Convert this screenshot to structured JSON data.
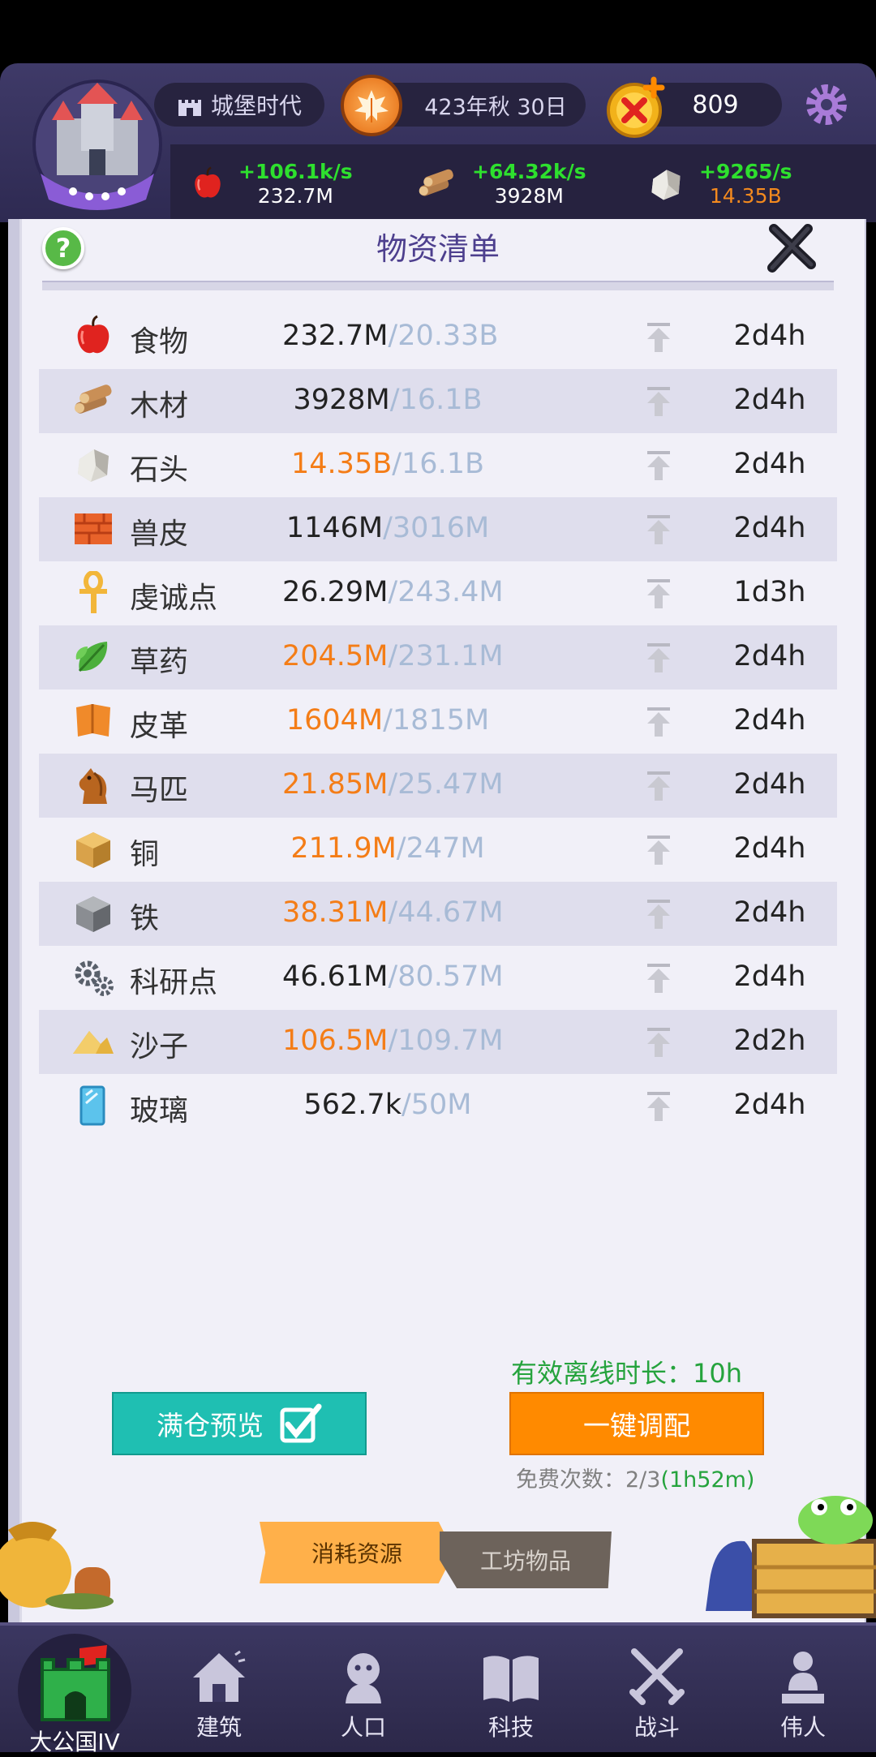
{
  "hud": {
    "era": "城堡时代",
    "date": "423年秋 30日",
    "coins": "809",
    "resources": [
      {
        "icon": "apple-icon",
        "rate": "+106.1k/s",
        "amount": "232.7M",
        "warn": false
      },
      {
        "icon": "wood-icon",
        "rate": "+64.32k/s",
        "amount": "3928M",
        "warn": false
      },
      {
        "icon": "stone-icon",
        "rate": "+9265/s",
        "amount": "14.35B",
        "warn": true
      }
    ]
  },
  "panel": {
    "title": "物资清单",
    "help": "?",
    "items": [
      {
        "icon": "apple-icon",
        "name": "食物",
        "current": "232.7M",
        "max": "/20.33B",
        "warn": false,
        "time": "2d4h"
      },
      {
        "icon": "wood-icon",
        "name": "木材",
        "current": "3928M",
        "max": "/16.1B",
        "warn": false,
        "time": "2d4h"
      },
      {
        "icon": "stone-icon",
        "name": "石头",
        "current": "14.35B",
        "max": "/16.1B",
        "warn": true,
        "time": "2d4h"
      },
      {
        "icon": "hide-icon",
        "name": "兽皮",
        "current": "1146M",
        "max": "/3016M",
        "warn": false,
        "time": "2d4h"
      },
      {
        "icon": "ankh-icon",
        "name": "虔诚点",
        "current": "26.29M",
        "max": "/243.4M",
        "warn": false,
        "time": "1d3h"
      },
      {
        "icon": "herb-icon",
        "name": "草药",
        "current": "204.5M",
        "max": "/231.1M",
        "warn": true,
        "time": "2d4h"
      },
      {
        "icon": "leather-icon",
        "name": "皮革",
        "current": "1604M",
        "max": "/1815M",
        "warn": true,
        "time": "2d4h"
      },
      {
        "icon": "horse-icon",
        "name": "马匹",
        "current": "21.85M",
        "max": "/25.47M",
        "warn": true,
        "time": "2d4h"
      },
      {
        "icon": "copper-icon",
        "name": "铜",
        "current": "211.9M",
        "max": "/247M",
        "warn": true,
        "time": "2d4h"
      },
      {
        "icon": "iron-icon",
        "name": "铁",
        "current": "38.31M",
        "max": "/44.67M",
        "warn": true,
        "time": "2d4h"
      },
      {
        "icon": "research-gears-icon",
        "name": "科研点",
        "current": "46.61M",
        "max": "/80.57M",
        "warn": false,
        "time": "2d4h"
      },
      {
        "icon": "sand-icon",
        "name": "沙子",
        "current": "106.5M",
        "max": "/109.7M",
        "warn": true,
        "time": "2d2h"
      },
      {
        "icon": "glass-icon",
        "name": "玻璃",
        "current": "562.7k",
        "max": "/50M",
        "warn": false,
        "time": "2d4h"
      }
    ],
    "offline_label": "有效离线时长：10h",
    "preview_label": "满仓预览",
    "dispatch_label": "一键调配",
    "free_label": "免费次数：2/3",
    "free_timer": "(1h52m)",
    "tabs": {
      "consume": "消耗资源",
      "workshop": "工坊物品"
    }
  },
  "nav": {
    "home": "大公国IV",
    "items": [
      {
        "label": "建筑",
        "icon": "house-icon"
      },
      {
        "label": "人口",
        "icon": "person-icon"
      },
      {
        "label": "科技",
        "icon": "book-icon"
      },
      {
        "label": "战斗",
        "icon": "crossed-swords-icon"
      },
      {
        "label": "伟人",
        "icon": "statue-icon"
      }
    ]
  },
  "colors": {
    "accent_orange": "#ff8a00",
    "teal": "#1fbfb2",
    "warn": "#f47d17",
    "good": "#25a33d",
    "hud": "#3f3a68"
  }
}
